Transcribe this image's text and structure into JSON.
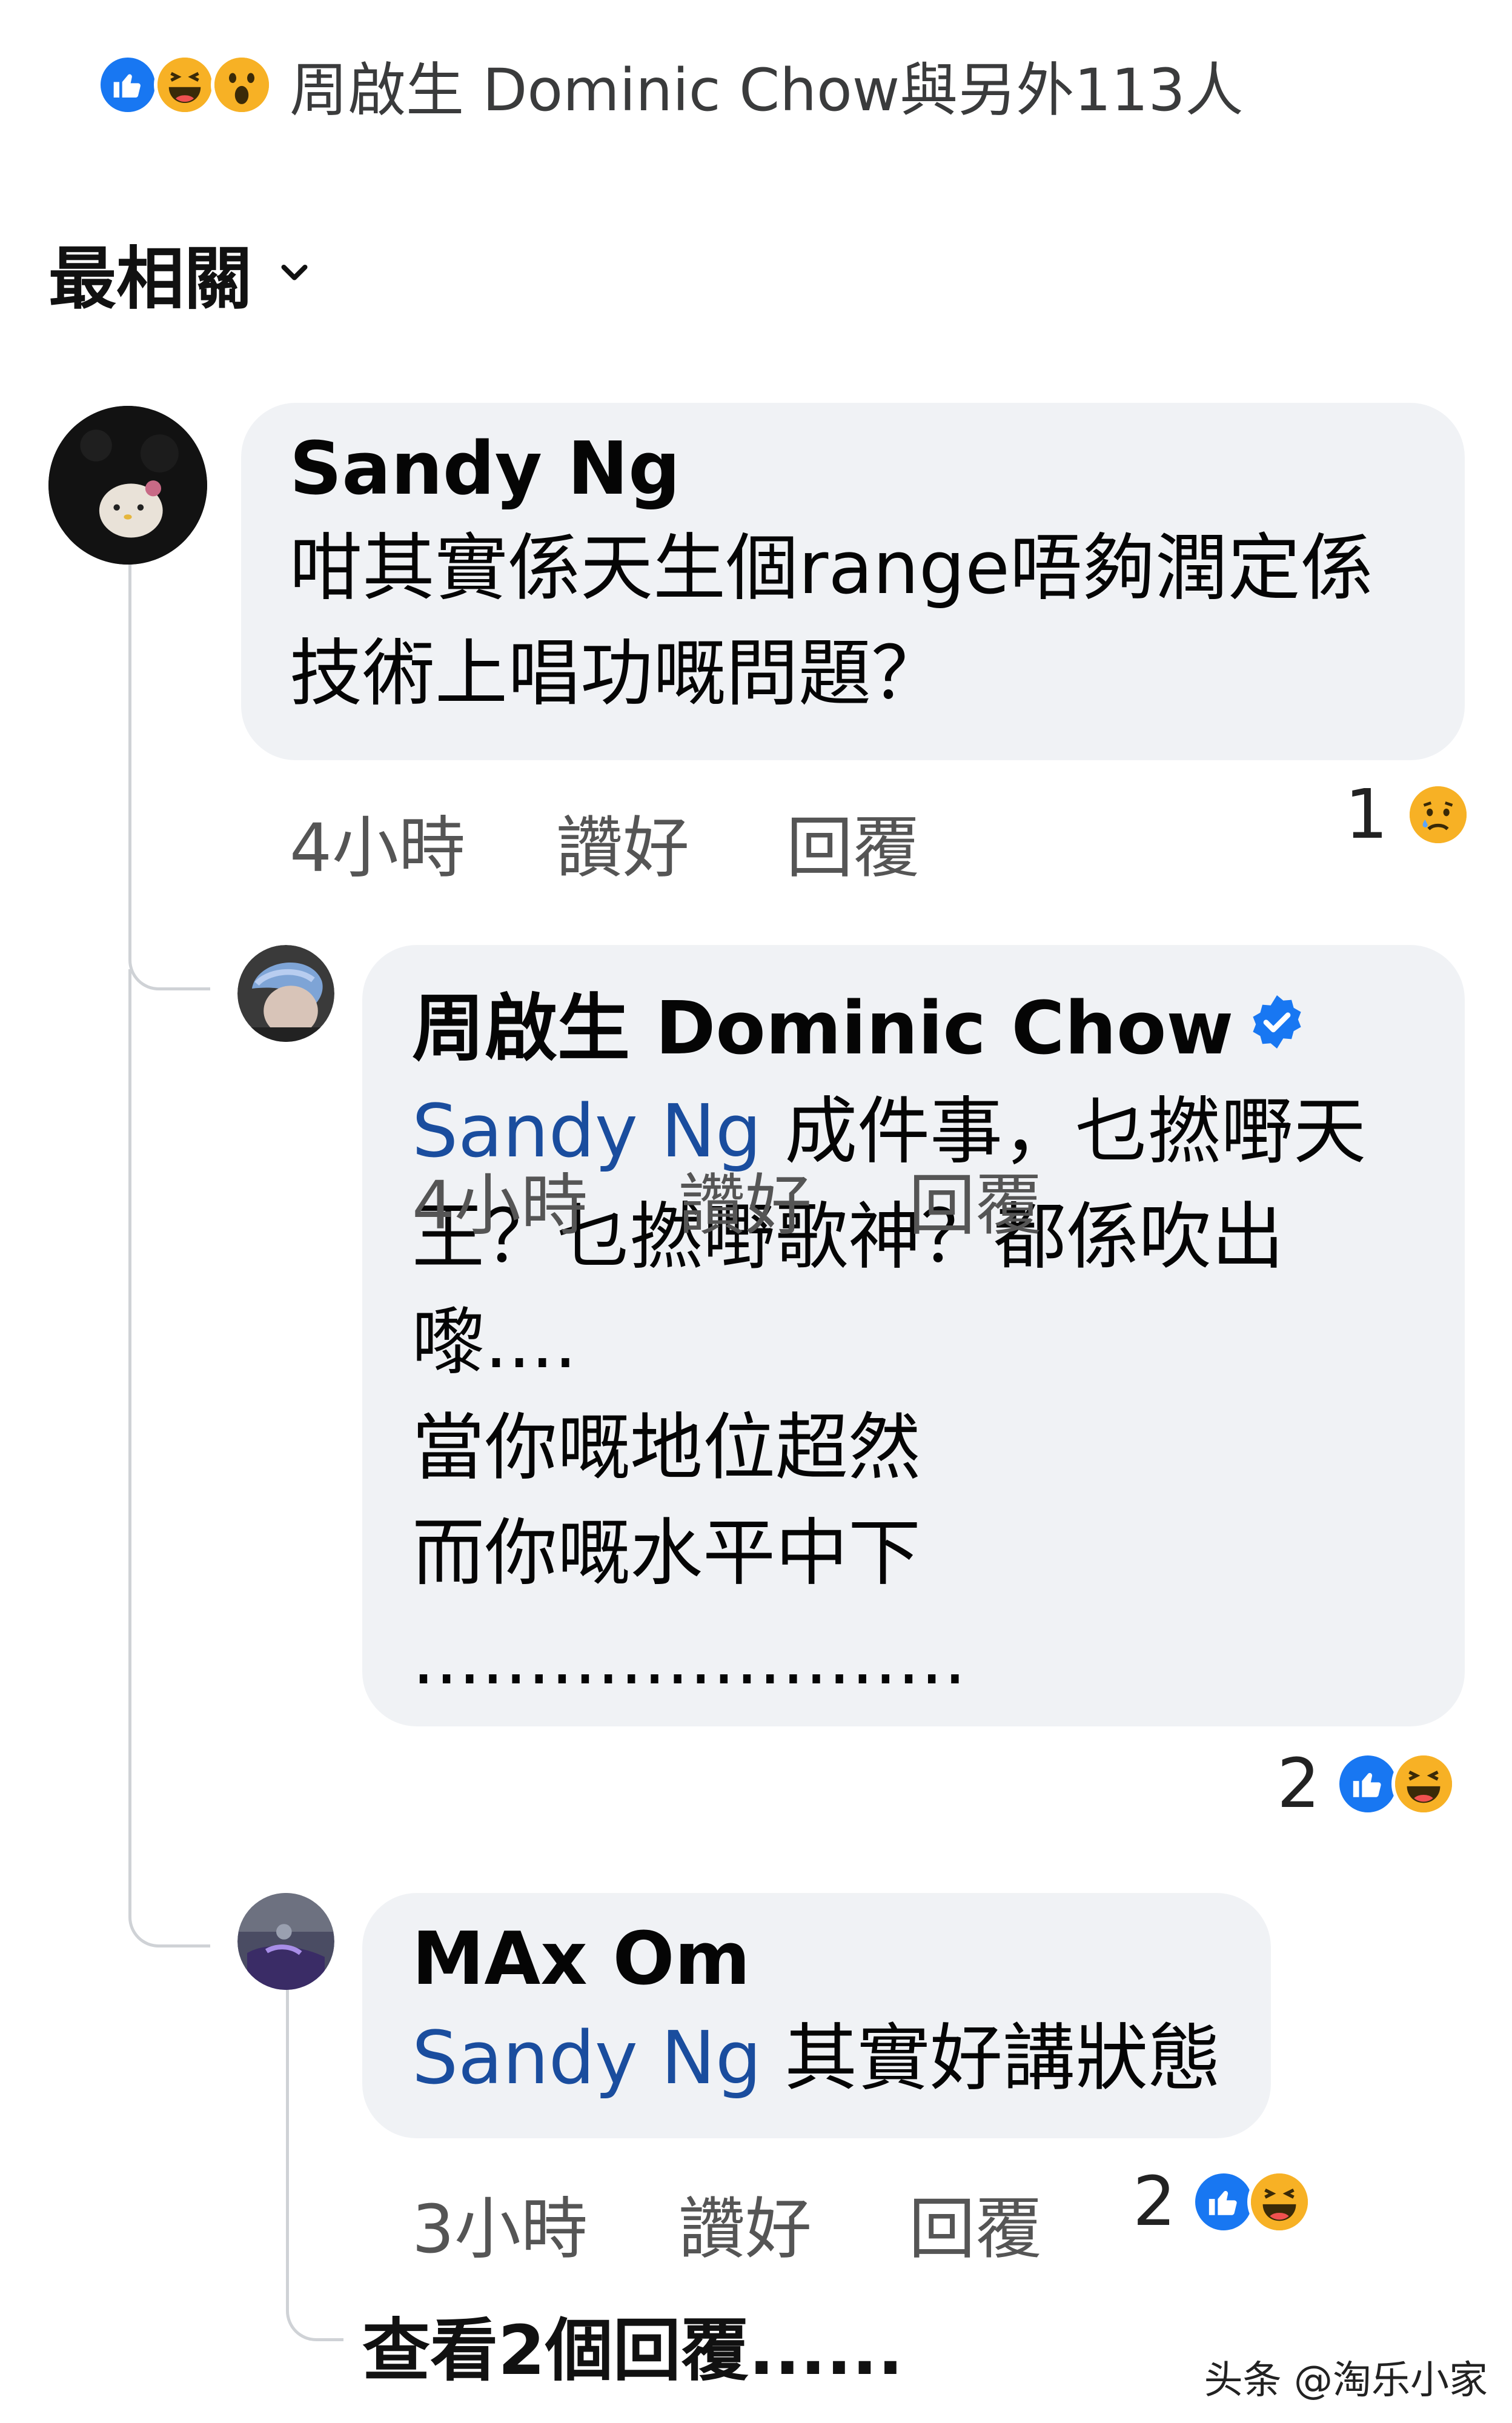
{
  "reactions_summary": {
    "icons": [
      "like-icon",
      "haha-icon",
      "wow-icon"
    ],
    "text": "周啟生 Dominic Chow與另外113人"
  },
  "sort": {
    "label": "最相關",
    "icon": "chevron-down-icon"
  },
  "comments": [
    {
      "author": "Sandy Ng",
      "text": "咁其實係天生個range唔夠潤定係\n技術上唱功嘅問題？",
      "time": "4小時",
      "like_label": "讚好",
      "reply_label": "回覆",
      "reaction_count": "1",
      "reaction_icons": [
        "sad-icon"
      ]
    },
    {
      "author": "周啟生 Dominic Chow",
      "verified": true,
      "mention": "Sandy Ng",
      "text": "成件事，乜撚嘢天\n王？乜撚嘢歌神？都係吹出\n嚟....\n當你嘅地位超然\n而你嘅水平中下\n........................",
      "time": "4小時",
      "like_label": "讚好",
      "reply_label": "回覆",
      "reaction_count": "2",
      "reaction_icons": [
        "like-icon",
        "haha-icon"
      ]
    },
    {
      "author": "MAx Om",
      "mention": "Sandy Ng",
      "text": "其實好講狀態",
      "time": "3小時",
      "like_label": "讚好",
      "reply_label": "回覆",
      "reaction_count": "2",
      "reaction_icons": [
        "like-icon",
        "haha-icon"
      ]
    }
  ],
  "more_replies": "查看2個回覆......",
  "watermark": "头条 @淘乐小家",
  "colors": {
    "like": "#1877f2",
    "emoji": "#f7b125",
    "bubble": "#f0f2f5",
    "mention": "#1a4d9e",
    "verified": "#1877f2"
  }
}
